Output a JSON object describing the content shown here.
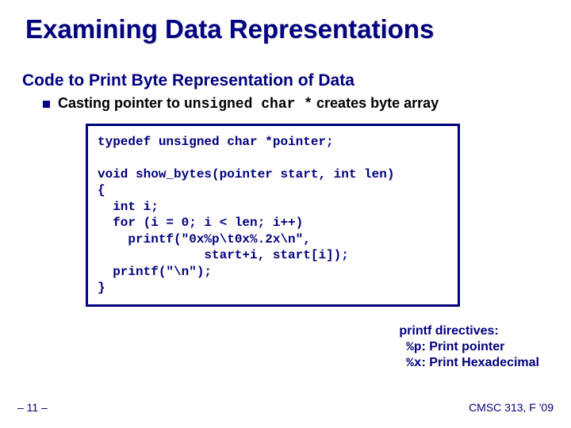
{
  "title": "Examining Data Representations",
  "subtitle": "Code to Print Byte Representation of Data",
  "bullet": {
    "pre": "Casting pointer to ",
    "code": "unsigned char *",
    "post": " creates byte array"
  },
  "code": "typedef unsigned char *pointer;\n\nvoid show_bytes(pointer start, int len)\n{\n  int i;\n  for (i = 0; i < len; i++)\n    printf(\"0x%p\\t0x%.2x\\n\",\n              start+i, start[i]);\n  printf(\"\\n\");\n}",
  "directives": {
    "heading": "printf directives:",
    "lines": [
      {
        "code": "%p",
        "text": "Print pointer"
      },
      {
        "code": "%x",
        "text": "Print Hexadecimal"
      }
    ]
  },
  "pagenum": "– 11 –",
  "course": "CMSC 313, F '09"
}
